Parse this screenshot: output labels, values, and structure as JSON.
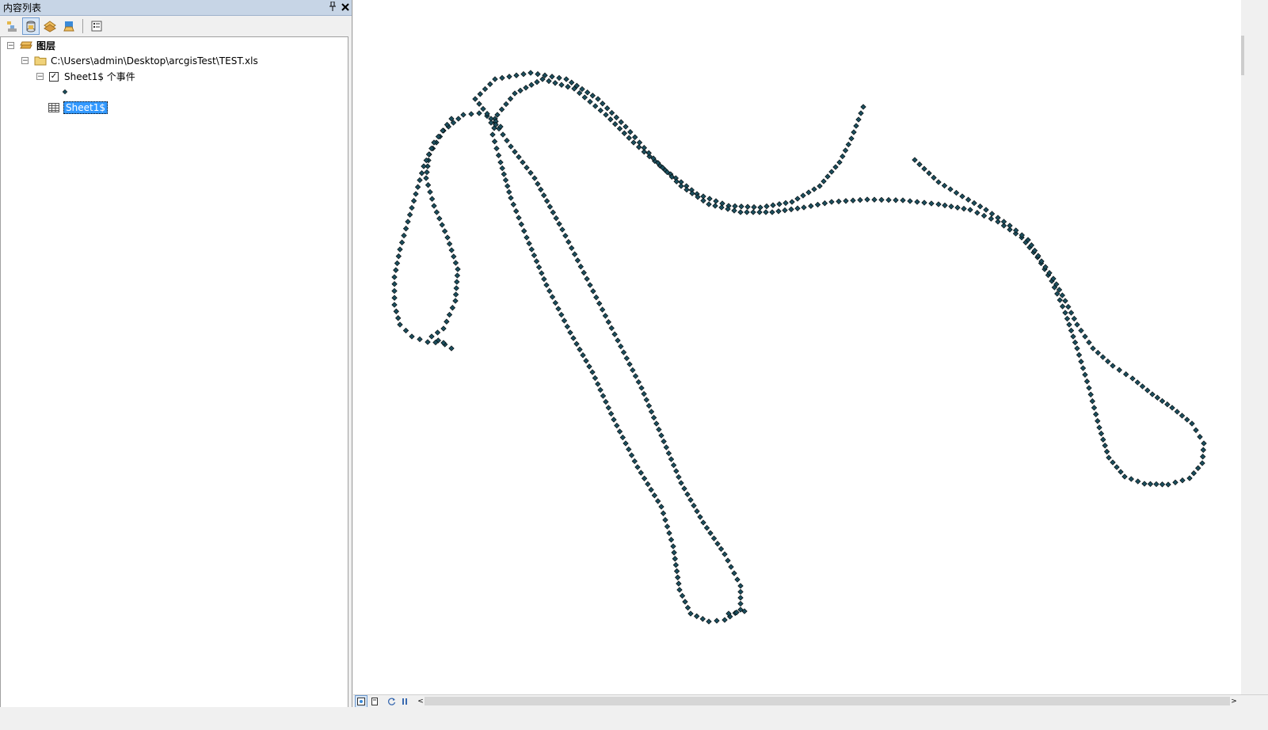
{
  "toc": {
    "title": "内容列表",
    "pin_glyph": "📌",
    "close_glyph": "✕",
    "toolbar": {
      "buttons": [
        {
          "name": "list-by-drawing-order",
          "icon": "layers-order-icon",
          "active": false
        },
        {
          "name": "list-by-source",
          "icon": "database-icon",
          "active": true
        },
        {
          "name": "list-by-visibility",
          "icon": "visibility-icon",
          "active": false
        },
        {
          "name": "list-by-selection",
          "icon": "selection-icon",
          "active": false
        },
        {
          "name": "options",
          "icon": "options-icon",
          "active": false
        }
      ]
    },
    "tree": {
      "root_label": "图层",
      "source_path": "C:\\Users\\admin\\Desktop\\arcgisTest\\TEST.xls",
      "layer_label": "Sheet1$ 个事件",
      "layer_checked": true,
      "table_label": "Sheet1$",
      "expander_glyph": "−",
      "check_glyph": "✓"
    }
  },
  "map": {
    "point_color": "#1b4d5c",
    "background": "#ffffff"
  },
  "statusbar": {
    "left_arrow": "<",
    "right_arrow": ">"
  }
}
